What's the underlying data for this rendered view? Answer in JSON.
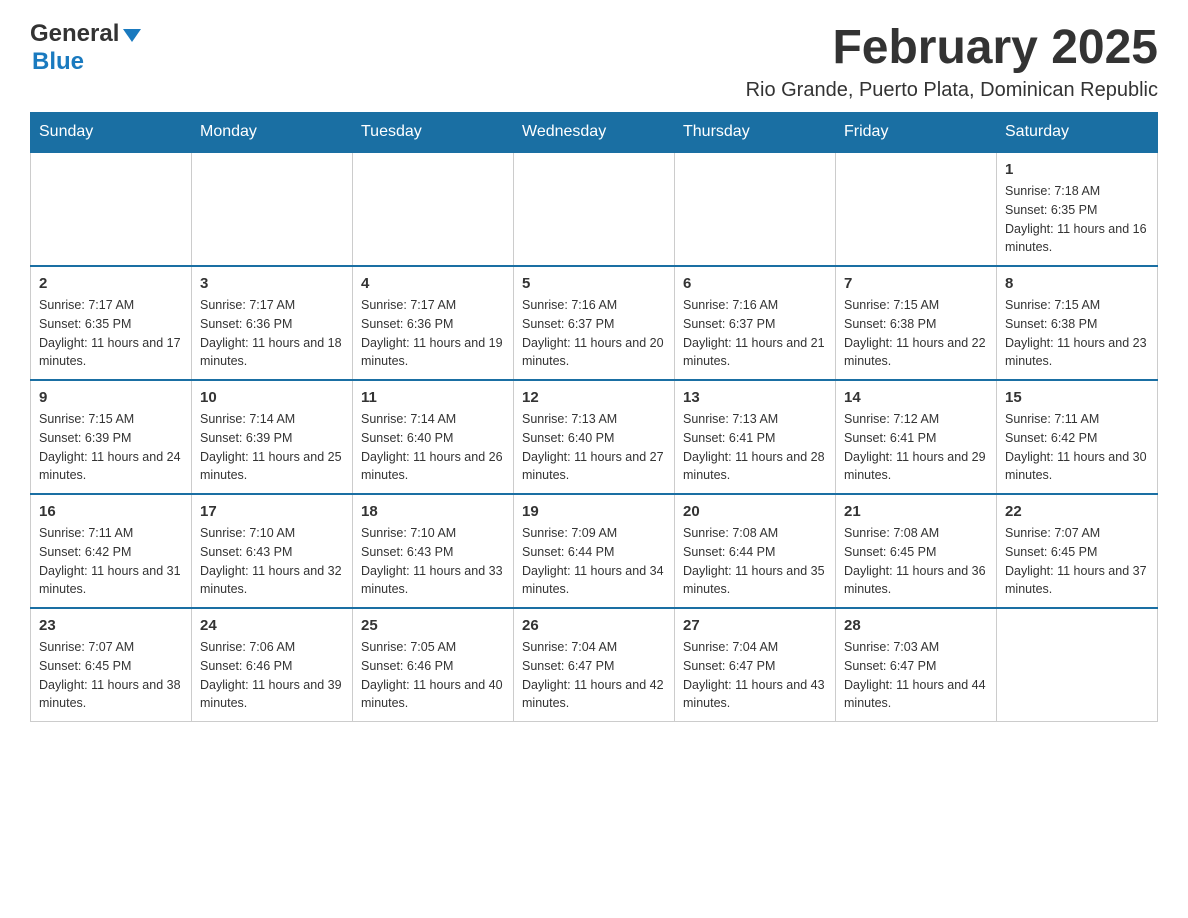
{
  "header": {
    "logo_general": "General",
    "logo_blue": "Blue",
    "title": "February 2025",
    "subtitle": "Rio Grande, Puerto Plata, Dominican Republic"
  },
  "days_of_week": [
    "Sunday",
    "Monday",
    "Tuesday",
    "Wednesday",
    "Thursday",
    "Friday",
    "Saturday"
  ],
  "weeks": [
    [
      {
        "day": "",
        "info": ""
      },
      {
        "day": "",
        "info": ""
      },
      {
        "day": "",
        "info": ""
      },
      {
        "day": "",
        "info": ""
      },
      {
        "day": "",
        "info": ""
      },
      {
        "day": "",
        "info": ""
      },
      {
        "day": "1",
        "info": "Sunrise: 7:18 AM\nSunset: 6:35 PM\nDaylight: 11 hours and 16 minutes."
      }
    ],
    [
      {
        "day": "2",
        "info": "Sunrise: 7:17 AM\nSunset: 6:35 PM\nDaylight: 11 hours and 17 minutes."
      },
      {
        "day": "3",
        "info": "Sunrise: 7:17 AM\nSunset: 6:36 PM\nDaylight: 11 hours and 18 minutes."
      },
      {
        "day": "4",
        "info": "Sunrise: 7:17 AM\nSunset: 6:36 PM\nDaylight: 11 hours and 19 minutes."
      },
      {
        "day": "5",
        "info": "Sunrise: 7:16 AM\nSunset: 6:37 PM\nDaylight: 11 hours and 20 minutes."
      },
      {
        "day": "6",
        "info": "Sunrise: 7:16 AM\nSunset: 6:37 PM\nDaylight: 11 hours and 21 minutes."
      },
      {
        "day": "7",
        "info": "Sunrise: 7:15 AM\nSunset: 6:38 PM\nDaylight: 11 hours and 22 minutes."
      },
      {
        "day": "8",
        "info": "Sunrise: 7:15 AM\nSunset: 6:38 PM\nDaylight: 11 hours and 23 minutes."
      }
    ],
    [
      {
        "day": "9",
        "info": "Sunrise: 7:15 AM\nSunset: 6:39 PM\nDaylight: 11 hours and 24 minutes."
      },
      {
        "day": "10",
        "info": "Sunrise: 7:14 AM\nSunset: 6:39 PM\nDaylight: 11 hours and 25 minutes."
      },
      {
        "day": "11",
        "info": "Sunrise: 7:14 AM\nSunset: 6:40 PM\nDaylight: 11 hours and 26 minutes."
      },
      {
        "day": "12",
        "info": "Sunrise: 7:13 AM\nSunset: 6:40 PM\nDaylight: 11 hours and 27 minutes."
      },
      {
        "day": "13",
        "info": "Sunrise: 7:13 AM\nSunset: 6:41 PM\nDaylight: 11 hours and 28 minutes."
      },
      {
        "day": "14",
        "info": "Sunrise: 7:12 AM\nSunset: 6:41 PM\nDaylight: 11 hours and 29 minutes."
      },
      {
        "day": "15",
        "info": "Sunrise: 7:11 AM\nSunset: 6:42 PM\nDaylight: 11 hours and 30 minutes."
      }
    ],
    [
      {
        "day": "16",
        "info": "Sunrise: 7:11 AM\nSunset: 6:42 PM\nDaylight: 11 hours and 31 minutes."
      },
      {
        "day": "17",
        "info": "Sunrise: 7:10 AM\nSunset: 6:43 PM\nDaylight: 11 hours and 32 minutes."
      },
      {
        "day": "18",
        "info": "Sunrise: 7:10 AM\nSunset: 6:43 PM\nDaylight: 11 hours and 33 minutes."
      },
      {
        "day": "19",
        "info": "Sunrise: 7:09 AM\nSunset: 6:44 PM\nDaylight: 11 hours and 34 minutes."
      },
      {
        "day": "20",
        "info": "Sunrise: 7:08 AM\nSunset: 6:44 PM\nDaylight: 11 hours and 35 minutes."
      },
      {
        "day": "21",
        "info": "Sunrise: 7:08 AM\nSunset: 6:45 PM\nDaylight: 11 hours and 36 minutes."
      },
      {
        "day": "22",
        "info": "Sunrise: 7:07 AM\nSunset: 6:45 PM\nDaylight: 11 hours and 37 minutes."
      }
    ],
    [
      {
        "day": "23",
        "info": "Sunrise: 7:07 AM\nSunset: 6:45 PM\nDaylight: 11 hours and 38 minutes."
      },
      {
        "day": "24",
        "info": "Sunrise: 7:06 AM\nSunset: 6:46 PM\nDaylight: 11 hours and 39 minutes."
      },
      {
        "day": "25",
        "info": "Sunrise: 7:05 AM\nSunset: 6:46 PM\nDaylight: 11 hours and 40 minutes."
      },
      {
        "day": "26",
        "info": "Sunrise: 7:04 AM\nSunset: 6:47 PM\nDaylight: 11 hours and 42 minutes."
      },
      {
        "day": "27",
        "info": "Sunrise: 7:04 AM\nSunset: 6:47 PM\nDaylight: 11 hours and 43 minutes."
      },
      {
        "day": "28",
        "info": "Sunrise: 7:03 AM\nSunset: 6:47 PM\nDaylight: 11 hours and 44 minutes."
      },
      {
        "day": "",
        "info": ""
      }
    ]
  ]
}
